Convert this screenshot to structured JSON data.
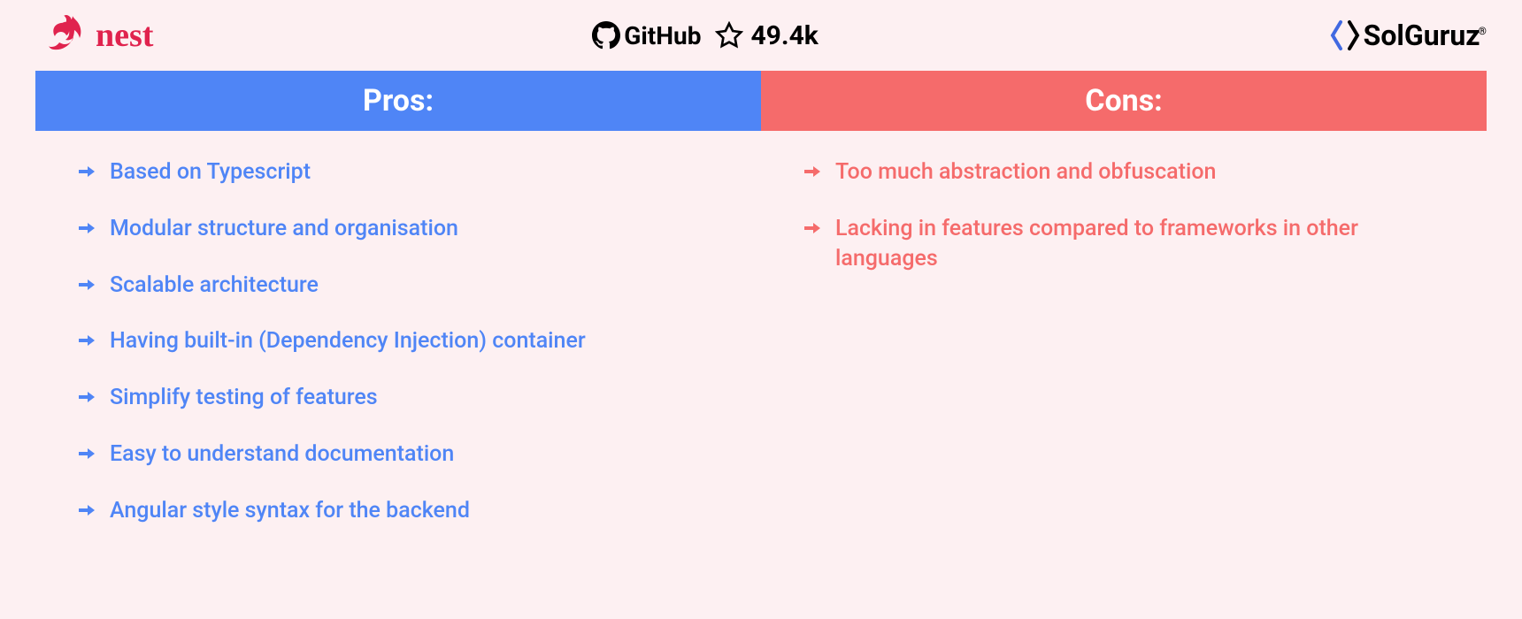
{
  "header": {
    "nest_label": "nest",
    "github_label": "GitHub",
    "star_count": "49.4k",
    "solguruz_label": "SolGuruz",
    "solguruz_trademark": "®"
  },
  "pros": {
    "title": "Pros:",
    "items": [
      "Based on Typescript",
      "Modular structure and organisation",
      "Scalable architecture",
      "Having built-in (Dependency Injection) container",
      "Simplify testing of features",
      "Easy to understand documentation",
      "Angular style syntax for the backend"
    ]
  },
  "cons": {
    "title": "Cons:",
    "items": [
      "Too much abstraction and obfuscation",
      "Lacking in features compared to frameworks in other languages"
    ]
  },
  "colors": {
    "background": "#fdf0f2",
    "pros_color": "#4f85f6",
    "cons_color": "#f56b6b",
    "nest_brand": "#e0234e"
  }
}
